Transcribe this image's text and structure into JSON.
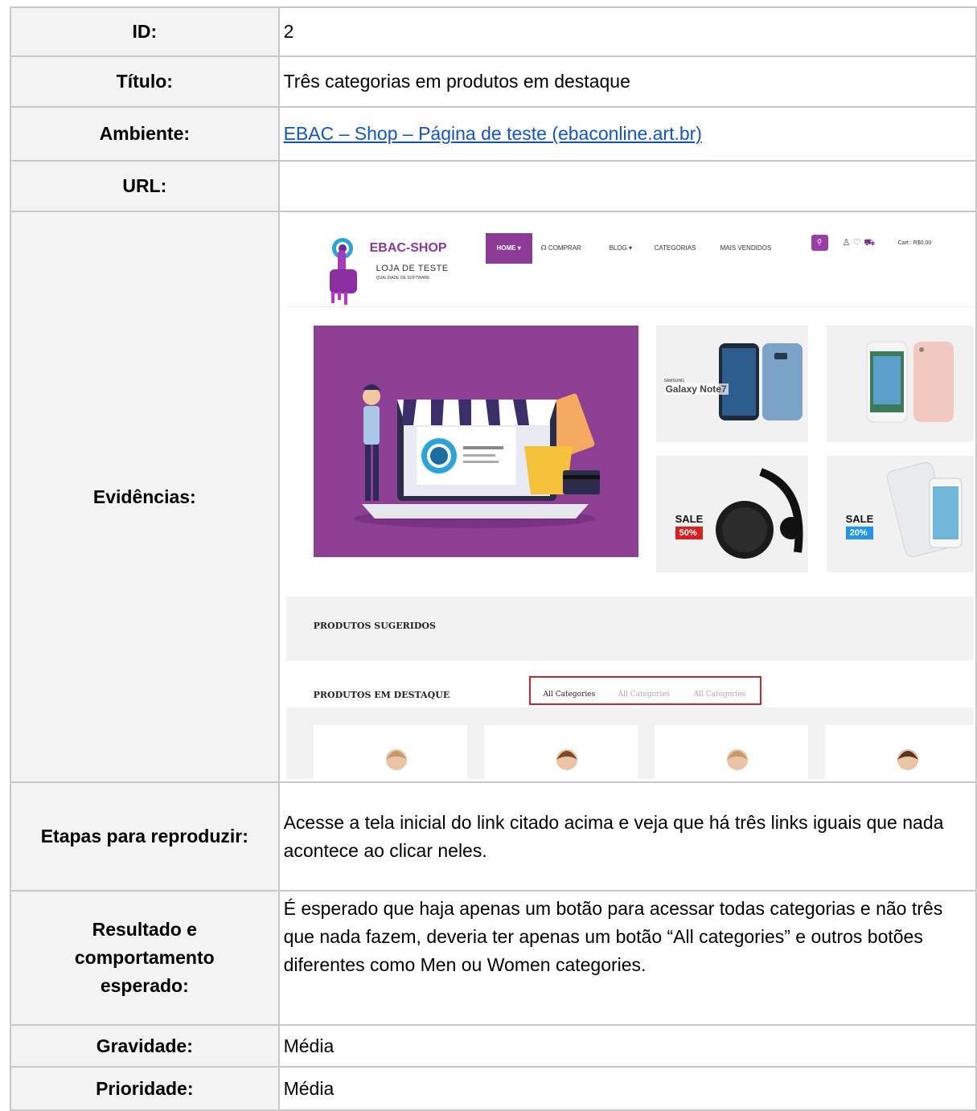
{
  "rows": {
    "id": {
      "label": "ID:",
      "value": "2"
    },
    "title": {
      "label": "Título:",
      "value": "Três categorias em produtos em destaque"
    },
    "env": {
      "label": "Ambiente:",
      "value": "EBAC – Shop – Página de teste (ebaconline.art.br)"
    },
    "url": {
      "label": "URL:",
      "value": ""
    },
    "evidence": {
      "label": "Evidências:"
    },
    "steps": {
      "label": "Etapas para reproduzir:",
      "value": "Acesse a tela inicial do link citado acima e veja que há três links iguais que nada acontece ao clicar neles."
    },
    "expected": {
      "label": "Resultado e comportamento esperado:",
      "value": "É esperado que haja apenas um botão para acessar todas categorias e não três que nada fazem, deveria ter apenas um botão “All categories” e outros botões diferentes como Men ou Women categories."
    },
    "severity": {
      "label": "Gravidade:",
      "value": "Média"
    },
    "priority": {
      "label": "Prioridade:",
      "value": "Média"
    }
  },
  "screenshot": {
    "brand": "EBAC-SHOP",
    "brand_sub": "LOJA DE TESTE",
    "brand_sub2": "QUALIDADE DE SOFTWARE",
    "nav": {
      "home": "HOME ▾",
      "comprar": "COMPRAR",
      "blog": "BLOG ▾",
      "categorias": "CATEGORIAS",
      "mais_vendidos": "MAIS VENDIDOS"
    },
    "cart": "Cart : R$0,00",
    "tiles": {
      "galaxy": "Galaxy Note7",
      "samsung": "SAMSUNG",
      "sale1_label": "SALE",
      "sale1_pct": "50%",
      "sale2_label": "SALE",
      "sale2_pct": "20%"
    },
    "sugeridos": "PRODUTOS SUGERIDOS",
    "destaque": "PRODUTOS EM DESTAQUE",
    "categories": [
      "All Categories",
      "All Categories",
      "All Categories"
    ],
    "colors": {
      "brand": "#8b3a95",
      "highlight_box": "#d3242a",
      "sale1": "#d9201f",
      "sale2": "#2196e8"
    }
  }
}
